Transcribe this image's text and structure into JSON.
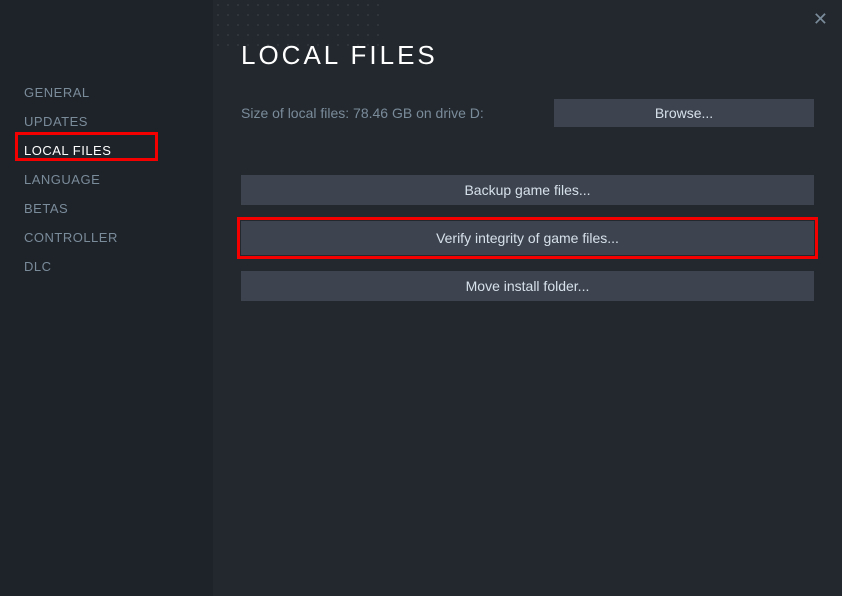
{
  "page_title": "LOCAL FILES",
  "close_label": "✕",
  "sidebar": {
    "items": [
      {
        "label": "GENERAL"
      },
      {
        "label": "UPDATES"
      },
      {
        "label": "LOCAL FILES"
      },
      {
        "label": "LANGUAGE"
      },
      {
        "label": "BETAS"
      },
      {
        "label": "CONTROLLER"
      },
      {
        "label": "DLC"
      }
    ]
  },
  "info": {
    "size_text": "Size of local files: 78.46 GB on drive D:"
  },
  "buttons": {
    "browse": "Browse...",
    "backup": "Backup game files...",
    "verify": "Verify integrity of game files...",
    "move": "Move install folder..."
  }
}
